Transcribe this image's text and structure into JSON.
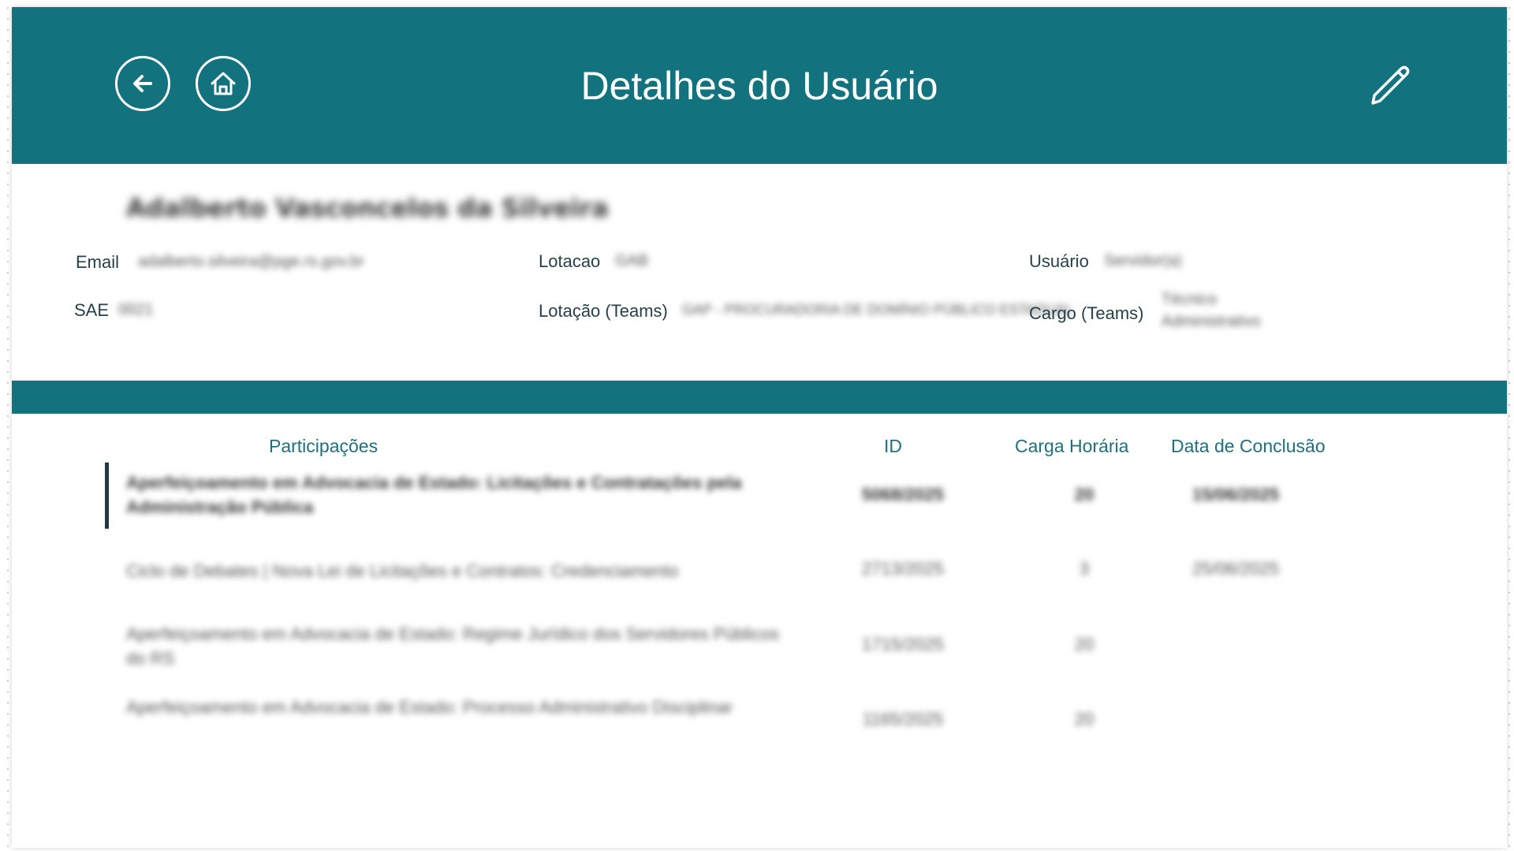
{
  "header": {
    "title": "Detalhes do Usuário",
    "back_icon": "arrow-left-icon",
    "home_icon": "home-icon",
    "edit_icon": "pencil-icon",
    "color": "#12737f"
  },
  "user": {
    "name": "Adalberto Vasconcelos da Silveira",
    "fields": {
      "email_label": "Email",
      "email_value": "adalberto.silveira@pge.rs.gov.br",
      "lotacao_label": "Lotacao",
      "lotacao_value": "GAB",
      "usuario_label": "Usuário",
      "usuario_value": "Servidor(a)",
      "sae_label": "SAE",
      "sae_value": "0021",
      "lotacao_teams_label": "Lotação (Teams)",
      "lotacao_teams_value": "GAP - PROCURADORIA DE DOMÍNIO PÚBLICO ESTADUAL",
      "cargo_teams_label": "Cargo (Teams)",
      "cargo_teams_value_line1": "Técnico",
      "cargo_teams_value_line2": "Administrativo"
    }
  },
  "table": {
    "columns": {
      "participacoes": "Participações",
      "id": "ID",
      "carga_horaria": "Carga Horária",
      "data_conclusao": "Data de Conclusão"
    },
    "rows": [
      {
        "title": "Aperfeiçoamento em Advocacia de Estado: Licitações e Contratações pela Administração Pública",
        "id": "5068/2025",
        "carga": "20",
        "data": "15/06/2025"
      },
      {
        "title": "Ciclo de Debates | Nova Lei de Licitações e Contratos: Credenciamento",
        "id": "2713/2025",
        "carga": "3",
        "data": "25/06/2025"
      },
      {
        "title": "Aperfeiçoamento em Advocacia de Estado: Regime Jurídico dos Servidores Públicos do RS",
        "id": "1715/2025",
        "carga": "20",
        "data": ""
      },
      {
        "title": "Aperfeiçoamento em Advocacia de Estado: Processo Administrativo Disciplinar",
        "id": "1165/2025",
        "carga": "20",
        "data": ""
      }
    ]
  }
}
